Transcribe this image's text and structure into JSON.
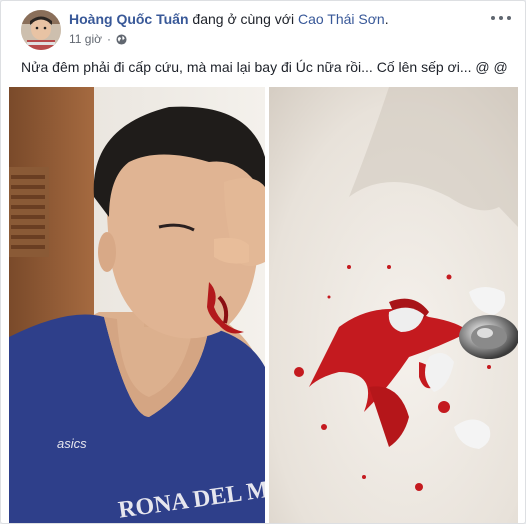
{
  "post": {
    "author": "Hoàng Quốc Tuấn",
    "with_text": "đang ở cùng với",
    "tagged_friend": "Cao Thái Sơn",
    "period": ".",
    "time": "11 giờ",
    "separator": "·",
    "privacy_icon": "globe-icon",
    "more_icon": "more-options-icon",
    "text": "Nửa đêm phải đi cấp cứu, mà mai lại bay đi Úc nữa rồi... Cố lên sếp ơi... @ @"
  },
  "photos": {
    "left": {
      "shirt_text_1": "asics",
      "shirt_text_2": "RONA DEL MAR"
    },
    "right": {}
  }
}
